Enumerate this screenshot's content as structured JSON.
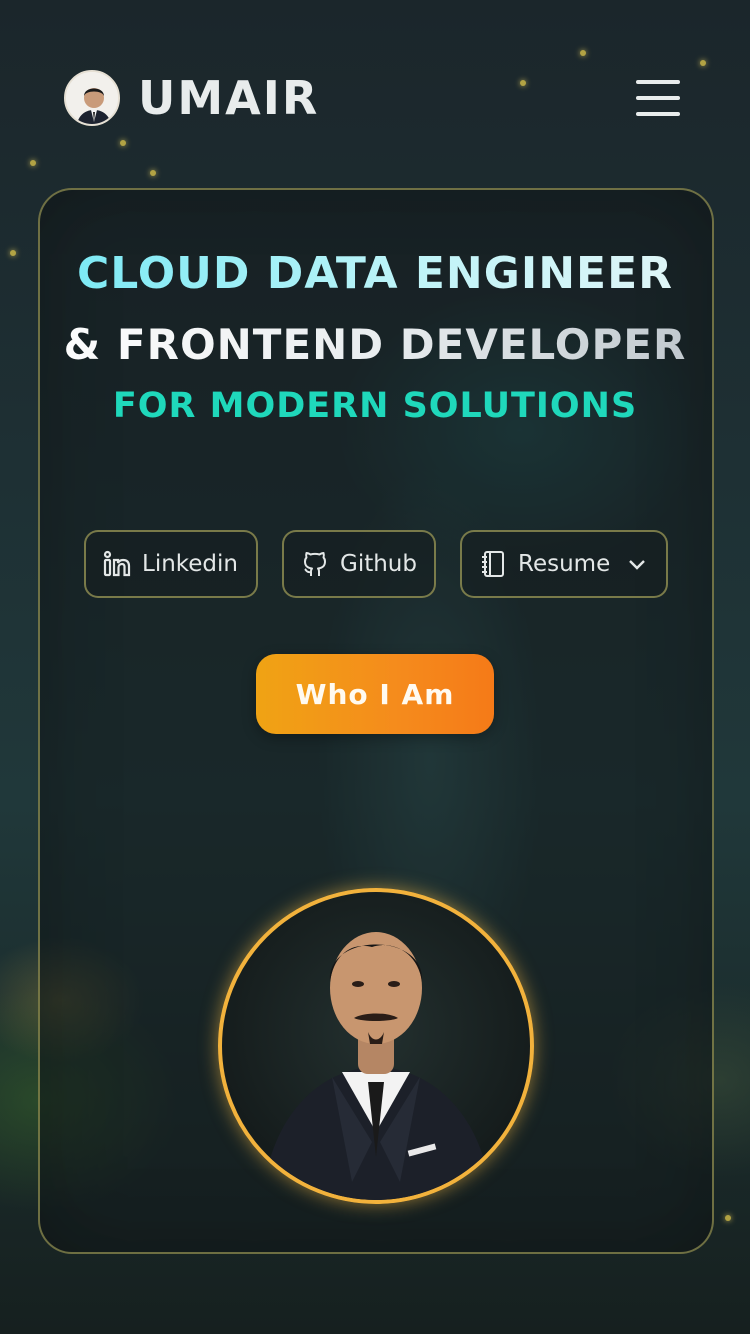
{
  "header": {
    "brand_name": "UMAIR"
  },
  "hero": {
    "title_line_1": "CLOUD DATA ENGINEER",
    "title_line_2": "& FRONTEND DEVELOPER",
    "title_line_3": "FOR MODERN SOLUTIONS"
  },
  "links": [
    {
      "label": "Linkedin",
      "icon": "linkedin-icon"
    },
    {
      "label": "Github",
      "icon": "github-icon"
    },
    {
      "label": "Resume",
      "icon": "notebook-icon"
    }
  ],
  "cta": {
    "label": "Who I Am"
  },
  "colors": {
    "accent_cyan": "#6ee7f4",
    "accent_teal": "#1fd8bb",
    "cta_orange": "#f58b1c",
    "ring_gold": "#f2b23c"
  }
}
